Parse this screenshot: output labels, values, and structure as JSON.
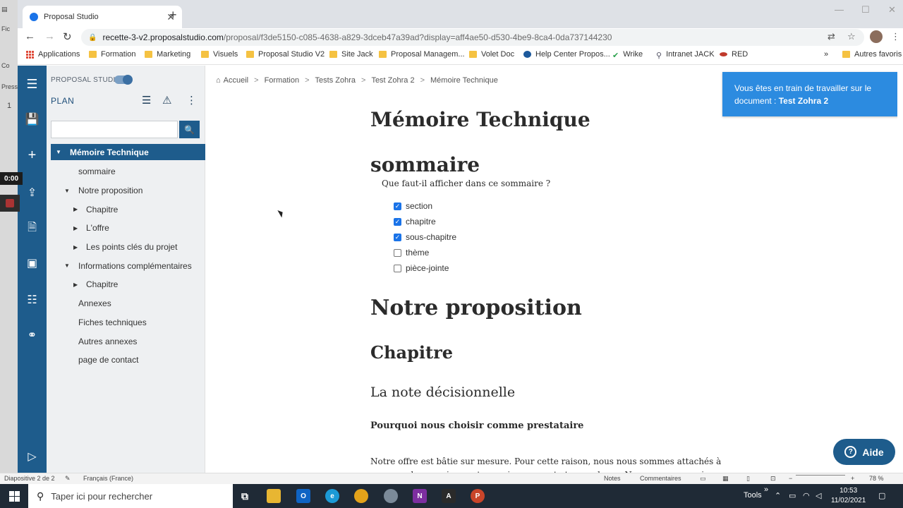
{
  "browser": {
    "tab_title": "Proposal Studio",
    "url_host": "recette-3-v2.proposalstudio.com",
    "url_path": "/proposal/f3de5150-c085-4638-a829-3dceb47a39ad?display=aff4ae50-d530-4be9-8ca4-0da737144230",
    "bookmarks": [
      "Applications",
      "Formation",
      "Marketing",
      "Visuels",
      "Proposal Studio V2",
      "Site Jack",
      "Proposal Managem...",
      "Volet Doc",
      "Help Center Propos...",
      "Wrike",
      "Intranet JACK",
      "RED"
    ],
    "bookmarks_more": "»",
    "other_bookmarks": "Autres favoris"
  },
  "background_ppt": {
    "labels": [
      "Fic",
      "Co",
      "Pressi",
      "1"
    ],
    "timer": "0:00"
  },
  "plan": {
    "brand": "PROPOSAL STUDIO",
    "title": "PLAN",
    "tree": [
      {
        "label": "Mémoire Technique",
        "level": 0,
        "caret": "▼",
        "selected": true
      },
      {
        "label": "sommaire",
        "level": 1,
        "caret": ""
      },
      {
        "label": "Notre proposition",
        "level": 1,
        "caret": "▼"
      },
      {
        "label": "Chapitre",
        "level": 2,
        "caret": "▶"
      },
      {
        "label": "L'offre",
        "level": 2,
        "caret": "▶"
      },
      {
        "label": "Les points clés du projet",
        "level": 2,
        "caret": "▶"
      },
      {
        "label": "Informations complémentaires",
        "level": 1,
        "caret": "▼"
      },
      {
        "label": "Chapitre",
        "level": 2,
        "caret": "▶"
      },
      {
        "label": "Annexes",
        "level": 1,
        "caret": ""
      },
      {
        "label": "Fiches techniques",
        "level": 1,
        "caret": ""
      },
      {
        "label": "Autres annexes",
        "level": 1,
        "caret": ""
      },
      {
        "label": "page de contact",
        "level": 1,
        "caret": ""
      }
    ]
  },
  "breadcrumb": [
    "Accueil",
    "Formation",
    "Tests Zohra",
    "Test Zohra 2",
    "Mémoire Technique"
  ],
  "document": {
    "title": "Mémoire Technique",
    "sommaire_title": "sommaire",
    "question": "Que faut-il afficher dans ce sommaire ?",
    "options": [
      {
        "label": "section",
        "checked": true
      },
      {
        "label": "chapitre",
        "checked": true
      },
      {
        "label": "sous-chapitre",
        "checked": true
      },
      {
        "label": "thème",
        "checked": false
      },
      {
        "label": "pièce-jointe",
        "checked": false
      }
    ],
    "section_title": "Notre proposition",
    "chapter_title": "Chapitre",
    "subtitle": "La note décisionnelle",
    "bold_heading": "Pourquoi nous choisir comme prestataire",
    "paragraph": "Notre offre est bâtie sur mesure. Pour cette raison, nous nous sommes attachés à comprendre au mieux votre environnement et vos valeurs. Nous avons conscience que vous :"
  },
  "toast": {
    "text": "Vous êtes en train de travailler sur le document : ",
    "doc_name": "Test Zohra 2"
  },
  "help_button": "Aide",
  "ppt_status": {
    "slide": "Diapositive 2 de 2",
    "language": "Français (France)",
    "notes": "Notes",
    "comments": "Commentaires",
    "zoom": "78 %"
  },
  "taskbar": {
    "search_placeholder": "Taper ici pour rechercher",
    "tools": "Tools",
    "time": "10:53",
    "date": "11/02/2021"
  },
  "colors": {
    "brand_blue": "#1e5c8c",
    "toast_blue": "#2c8be0",
    "checkbox_blue": "#1a73e8"
  }
}
